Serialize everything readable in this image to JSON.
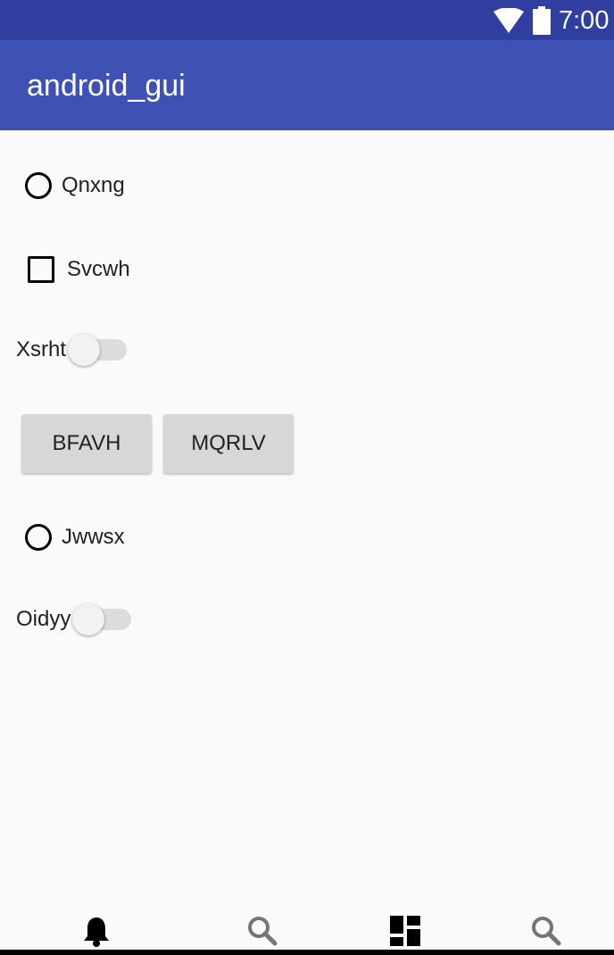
{
  "status_bar": {
    "time": "7:00",
    "wifi_icon": "wifi-icon",
    "battery_icon": "battery-icon"
  },
  "app_bar": {
    "title": "android_gui"
  },
  "controls": {
    "radio_1": {
      "label": "Qnxng",
      "checked": false
    },
    "checkbox_1": {
      "label": "Svcwh",
      "checked": false
    },
    "switch_1": {
      "label": "Xsrht",
      "on": false
    },
    "buttons": [
      "BFAVH",
      "MQRLV"
    ],
    "radio_2": {
      "label": "Jwwsx",
      "checked": false
    },
    "switch_2": {
      "label": "Oidyy",
      "on": false
    }
  },
  "bottom_nav": {
    "items": [
      {
        "icon": "bell-icon",
        "active": true
      },
      {
        "icon": "search-icon",
        "active": false
      },
      {
        "icon": "dashboard-icon",
        "active": false
      },
      {
        "icon": "search-icon",
        "active": false
      }
    ]
  },
  "colors": {
    "status_bar": "#303f9f",
    "app_bar": "#3f51b5",
    "background": "#fafafa",
    "button": "#d6d7d7",
    "nav_active": "#000000",
    "nav_inactive": "#757575"
  }
}
